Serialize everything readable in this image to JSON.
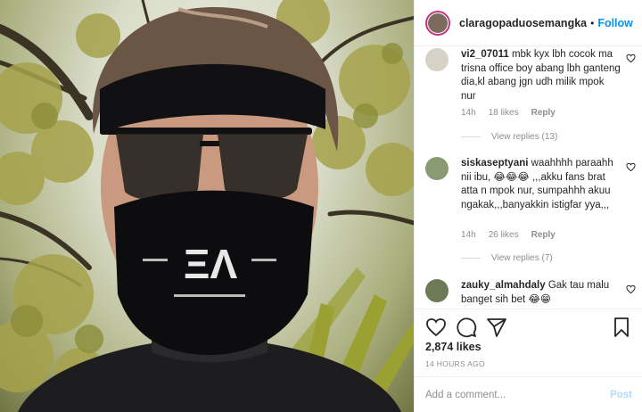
{
  "header": {
    "username": "claragopaduosemangka",
    "separator": "•",
    "follow_label": "Follow"
  },
  "mask_print": "ΞΛ",
  "comments": [
    {
      "username": "vi2_07011",
      "text": "mbk kyx lbh cocok ma trisna office boy abang lbh ganteng dia,kl abang jgn udh milik mpok nur",
      "time": "14h",
      "likes": "18 likes",
      "reply": "Reply",
      "view_replies": "View replies (13)"
    },
    {
      "username": "siskaseptyani",
      "text": "waahhhh paraahh nii ibu, 😂😂😂 ,,,akku fans brat atta n mpok nur, sumpahhh akuu ngakak,,,banyakkin istigfar yya,,,",
      "time": "14h",
      "likes": "26 likes",
      "reply": "Reply",
      "view_replies": "View replies (7)"
    },
    {
      "username": "zauky_almahdaly",
      "text": "Gak tau malu banget sih bet 😂😁"
    }
  ],
  "likes_count": "2,874 likes",
  "timestamp": "14 HOURS AGO",
  "add_comment": {
    "placeholder": "Add a comment...",
    "post_label": "Post"
  },
  "colors": {
    "follow_blue": "#0095f6",
    "post_disabled": "#b3dbff",
    "muted": "#8e8e8e",
    "story_ring": "#c13584"
  },
  "icons": [
    "heart-icon",
    "comment-icon",
    "share-icon",
    "bookmark-icon",
    "small-heart-icon"
  ]
}
